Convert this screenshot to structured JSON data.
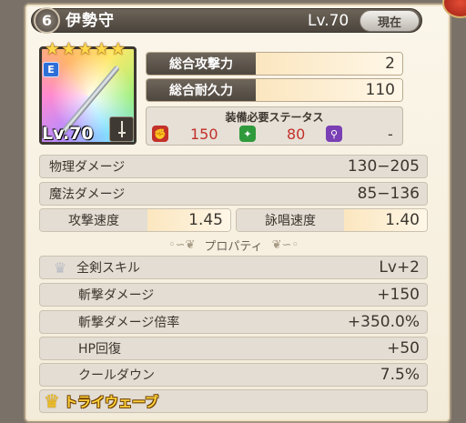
{
  "header": {
    "rarity": "6",
    "name": "伊勢守",
    "level": "Lv.70",
    "current_label": "現在"
  },
  "card": {
    "stars": [
      "★",
      "★",
      "★",
      "★",
      "★"
    ],
    "element": "E",
    "level": "Lv.70",
    "weapon_type_icon": "sword-icon"
  },
  "stats": {
    "total_attack": {
      "label": "総合攻撃力",
      "value": "2"
    },
    "total_durability": {
      "label": "総合耐久力",
      "value": "110"
    }
  },
  "requirements": {
    "title": "装備必要ステータス",
    "items": [
      {
        "icon": "fist-icon",
        "color": "#c3302a",
        "value": "150",
        "value_color": "#c3302a"
      },
      {
        "icon": "leaf-icon",
        "color": "#2f9a3c",
        "value": "80",
        "value_color": "#c3302a"
      },
      {
        "icon": "staff-icon",
        "color": "#7a3fb4",
        "value": "-",
        "value_color": "#3c3630"
      }
    ]
  },
  "damage": {
    "physical": {
      "label": "物理ダメージ",
      "value": "130−205"
    },
    "magic": {
      "label": "魔法ダメージ",
      "value": "85−136"
    }
  },
  "speed": {
    "attack": {
      "label": "攻撃速度",
      "value": "1.45"
    },
    "cast": {
      "label": "詠唱速度",
      "value": "1.40"
    }
  },
  "properties": {
    "title": "プロパティ",
    "rows": [
      {
        "label": "全剣スキル",
        "value": "Lv+2"
      },
      {
        "label": "斬撃ダメージ",
        "value": "+150"
      },
      {
        "label": "斬撃ダメージ倍率",
        "value": "+350.0%"
      },
      {
        "label": "HP回復",
        "value": "+50"
      },
      {
        "label": "クールダウン",
        "value": "7.5%"
      }
    ]
  },
  "trait": {
    "name": "トライウェーブ"
  }
}
